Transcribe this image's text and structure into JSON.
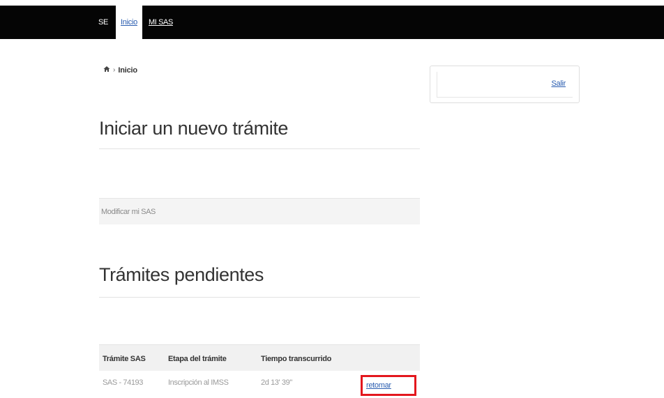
{
  "nav": {
    "items": [
      {
        "label": "SE"
      },
      {
        "label": "Inicio"
      },
      {
        "label": "MI SAS"
      }
    ]
  },
  "breadcrumb": {
    "home_icon": "home-icon",
    "separator": "›",
    "current": "Inicio"
  },
  "sidebar": {
    "logout_label": "Salir"
  },
  "main": {
    "new_procedure_heading": "Iniciar un nuevo trámite",
    "modify_link": "Modificar mi SAS",
    "pending_heading": "Trámites pendientes",
    "table": {
      "columns": [
        "Trámite SAS",
        "Etapa del trámite",
        "Tiempo transcurrido"
      ],
      "rows": [
        {
          "tramite": "SAS - 74193",
          "etapa": "Inscripción al IMSS",
          "tiempo": "2d 13' 39\"",
          "action": "retomar"
        }
      ]
    }
  },
  "colors": {
    "navbar": "#050505",
    "link": "#2a5db0",
    "highlight": "#e3171d"
  }
}
